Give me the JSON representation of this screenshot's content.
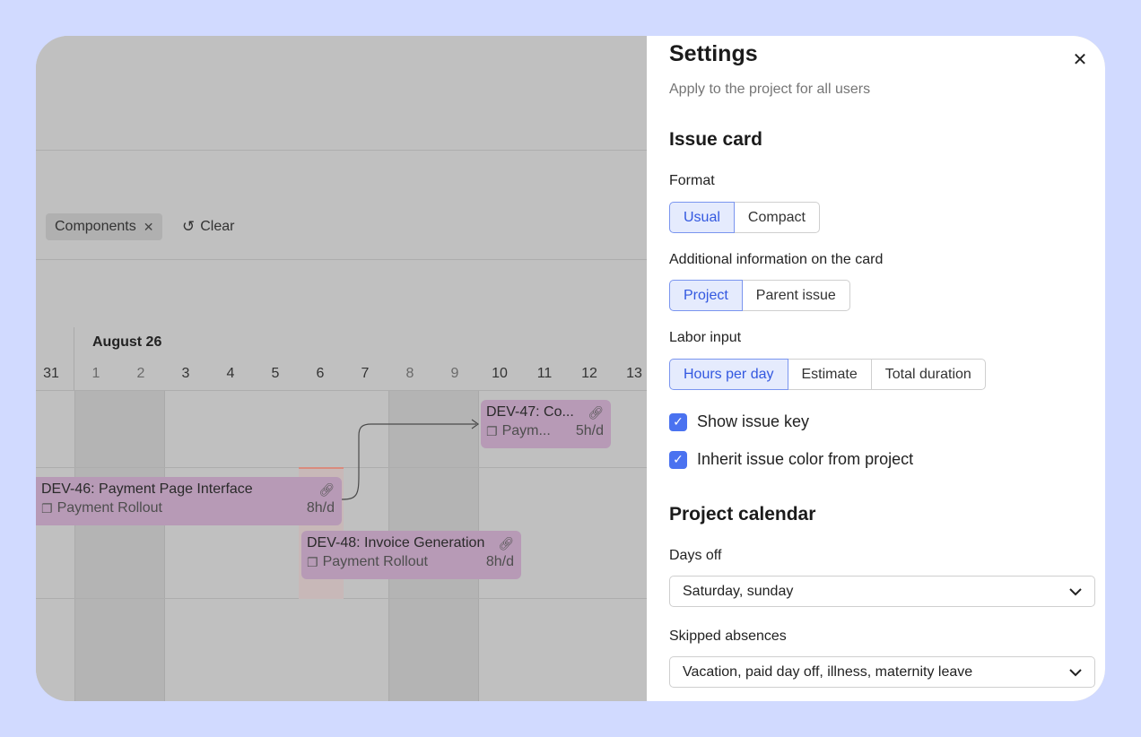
{
  "timeline": {
    "filter_chip": "Components",
    "clear_label": "Clear",
    "month_label": "August 26",
    "days": [
      "31",
      "1",
      "2",
      "3",
      "4",
      "5",
      "6",
      "7",
      "8",
      "9",
      "10",
      "11",
      "12",
      "13"
    ],
    "cards": [
      {
        "key_title": "DEV-47: Co...",
        "project": "Paym...",
        "labor": "5h/d"
      },
      {
        "key_title": "DEV-46: Payment Page Interface",
        "project": "Payment Rollout",
        "labor": "8h/d"
      },
      {
        "key_title": "DEV-48: Invoice Generation",
        "project": "Payment Rollout",
        "labor": "8h/d"
      }
    ],
    "colors": {
      "card": "#b79ab6",
      "today_marker": "#d98b7e"
    }
  },
  "settings": {
    "title": "Settings",
    "subtitle": "Apply to the project for all users",
    "issue_card": {
      "heading": "Issue card",
      "format": {
        "label": "Format",
        "options": [
          "Usual",
          "Compact"
        ],
        "selected": "Usual"
      },
      "additional": {
        "label": "Additional information on the card",
        "options": [
          "Project",
          "Parent issue"
        ],
        "selected": "Project"
      },
      "labor": {
        "label": "Labor input",
        "options": [
          "Hours per day",
          "Estimate",
          "Total duration"
        ],
        "selected": "Hours per day"
      },
      "show_key": {
        "label": "Show issue key",
        "checked": true
      },
      "inherit_color": {
        "label": "Inherit issue color from project",
        "checked": true
      }
    },
    "project_calendar": {
      "heading": "Project calendar",
      "days_off": {
        "label": "Days off",
        "value": "Saturday, sunday"
      },
      "skipped": {
        "label": "Skipped absences",
        "value": "Vacation, paid day off, illness, maternity leave"
      }
    },
    "colors": {
      "accent": "#4a72f0",
      "active_bg": "#e5ebfd"
    }
  }
}
